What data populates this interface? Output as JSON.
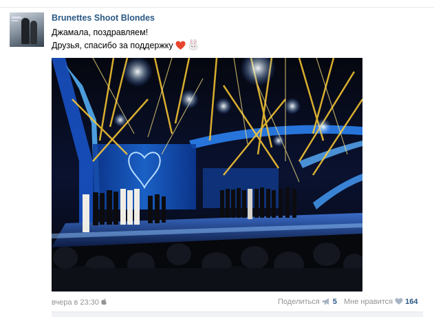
{
  "post": {
    "author": "Brunettes Shoot Blondes",
    "line1": "Джамала, поздравляем!",
    "line2": "Друзья, спасибо за поддержку",
    "emojis": [
      "heart-icon",
      "rabbit-icon"
    ]
  },
  "footer": {
    "time": "вчера в 23:30",
    "device_icon": "apple-icon",
    "share_label": "Поделиться",
    "share_count": "5",
    "like_label": "Мне нравится",
    "like_count": "164"
  },
  "colors": {
    "link": "#2a5885",
    "muted": "#939393",
    "divider": "#e7e8ec"
  }
}
